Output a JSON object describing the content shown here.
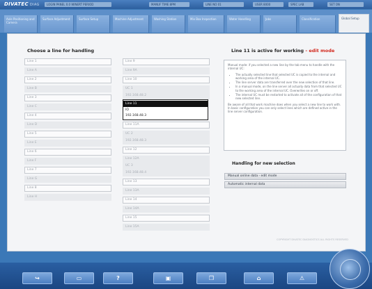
{
  "header": {
    "logo": "DIVATEC",
    "logo_sub": "DIAG",
    "fields": [
      "LOGIN PANEL 0.0  WINERT PERIOD",
      "MANUF  TIME 8PM",
      "LINE NO 01",
      "USER  8000",
      "SPEC  LAB",
      "SET ON"
    ]
  },
  "tabs": [
    {
      "label": "Axle Positioning and Camera"
    },
    {
      "label": "Surface Adjustment"
    },
    {
      "label": "Surface Setup"
    },
    {
      "label": "Machine Adjustment"
    },
    {
      "label": "Washing Station"
    },
    {
      "label": "Mix Box Inspection"
    },
    {
      "label": "Water Handling"
    },
    {
      "label": "Jobs"
    },
    {
      "label": "Classification"
    },
    {
      "label": "Global Setup"
    }
  ],
  "left_panel": {
    "title": "Choose a line for handling",
    "col1": [
      "Line 1",
      "Line A",
      "Line 2",
      "Line B",
      "Line 3",
      "Line C",
      "Line 4",
      "Line D",
      "Line 5",
      "Line E",
      "Line 6",
      "Line F",
      "Line 7",
      "Line G",
      "Line 8",
      "Line H"
    ],
    "col2": [
      "Line 9",
      "Line 9A",
      "Line 10",
      "UC 1",
      "192.168.48.2",
      "Line 11",
      "Line 11A",
      "UC 2",
      "192.168.48.3",
      "Line 12",
      "Line 12A",
      "UC 3",
      "192.168.48.4",
      "Line 13",
      "Line 13A",
      "Line 14",
      "Line 14A",
      "Line 15",
      "Line 15A"
    ],
    "popup": [
      "Line 11",
      "IO",
      "192.168.48.3"
    ]
  },
  "right_panel": {
    "title": "Line 11 is active for working",
    "title_highlight": "- edit mode",
    "info_intro": "Manual mode: if you selected a new line by the tab menu to handle with the internal UC:",
    "info_bullets": [
      "The actually selected line that selected UC is copied to the internal and working area of the internal UC.",
      "The line server data are transferred over the new selection of that line.",
      "In a manual mode, on the line server all actually data from that selected UC to the working area of the internal UC. Overwrites on or off.",
      "The internal UC must be restarted to activate all of the configuration of that new selected line."
    ],
    "info_outro": "Be aware of all that work machine does when you select a new line to work with. In basic configuration you can only select lines which are defined active in the line server configuration.",
    "handling_title": "Handling for new selection",
    "buttons": [
      "Manual online data - edit mode",
      "Automatic internal data"
    ]
  },
  "footer_note": "COPYRIGHT DIVATEC DIAGNOSTICS  ALL RIGHTS RESERVED",
  "bottom_bar": {
    "buttons": [
      {
        "icon": "login-icon",
        "glyph": "↪"
      },
      {
        "icon": "keyboard-icon",
        "glyph": "▭"
      },
      {
        "icon": "help-icon",
        "glyph": "?"
      },
      {
        "icon": "print-icon",
        "glyph": "▣"
      },
      {
        "icon": "copy-icon",
        "glyph": "❐"
      },
      {
        "icon": "home-icon",
        "glyph": "⌂"
      },
      {
        "icon": "warning-icon",
        "glyph": "⚠"
      }
    ]
  },
  "colors": {
    "accent": "#3b78b7",
    "highlight": "#d2291e"
  }
}
